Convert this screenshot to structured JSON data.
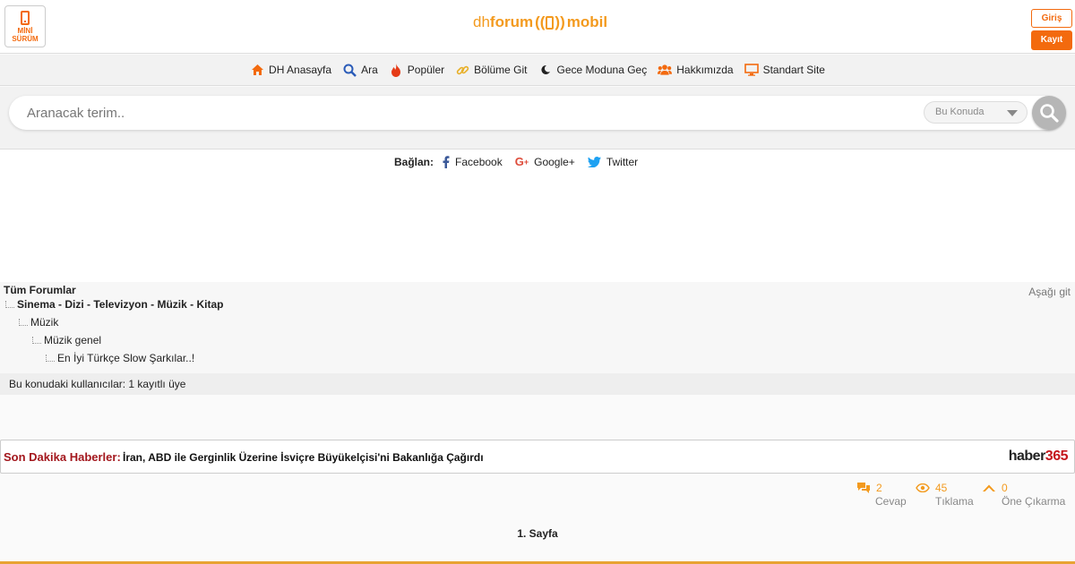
{
  "header": {
    "mini_label": "MİNİ SÜRÜM",
    "logo_part1": "dh",
    "logo_part2": "forum",
    "logo_part3": "mobil",
    "login_label": "Giriş",
    "register_label": "Kayıt",
    "accent_color": "#f36a0e"
  },
  "nav": {
    "items": [
      {
        "icon": "home-icon",
        "label": "DH Anasayfa"
      },
      {
        "icon": "search-icon",
        "label": "Ara"
      },
      {
        "icon": "flame-icon",
        "label": "Popüler"
      },
      {
        "icon": "link-icon",
        "label": "Bölüme Git"
      },
      {
        "icon": "moon-icon",
        "label": "Gece Moduna Geç"
      },
      {
        "icon": "users-icon",
        "label": "Hakkımızda"
      },
      {
        "icon": "monitor-icon",
        "label": "Standart Site"
      }
    ]
  },
  "search": {
    "placeholder": "Aranacak terim..",
    "scope_value": "Bu Konuda"
  },
  "connect": {
    "label": "Bağlan:",
    "facebook": "Facebook",
    "google": "Google+",
    "twitter": "Twitter"
  },
  "breadcrumb": {
    "root": "Tüm Forumlar",
    "scroll_down": "Aşağı git",
    "level1": "Sinema - Dizi - Televizyon - Müzik - Kitap",
    "level2": "Müzik",
    "level3": "Müzik genel",
    "level4": "En İyi Türkçe Slow Şarkılar..!"
  },
  "users_bar": "Bu konudaki kullanıcılar: 1 kayıtlı üye",
  "news": {
    "label": "Son Dakika Haberler:",
    "headline": "İran, ABD ile Gerginlik Üzerine İsviçre Büyükelçisi'ni Bakanlığa Çağırdı",
    "brand_text": "haber",
    "brand_num": "365"
  },
  "stats": {
    "replies_count": "2",
    "replies_label": "Cevap",
    "views_count": "45",
    "views_label": "Tıklama",
    "upvotes_count": "0",
    "upvotes_label": "Öne Çıkarma"
  },
  "pagination": "1. Sayfa"
}
